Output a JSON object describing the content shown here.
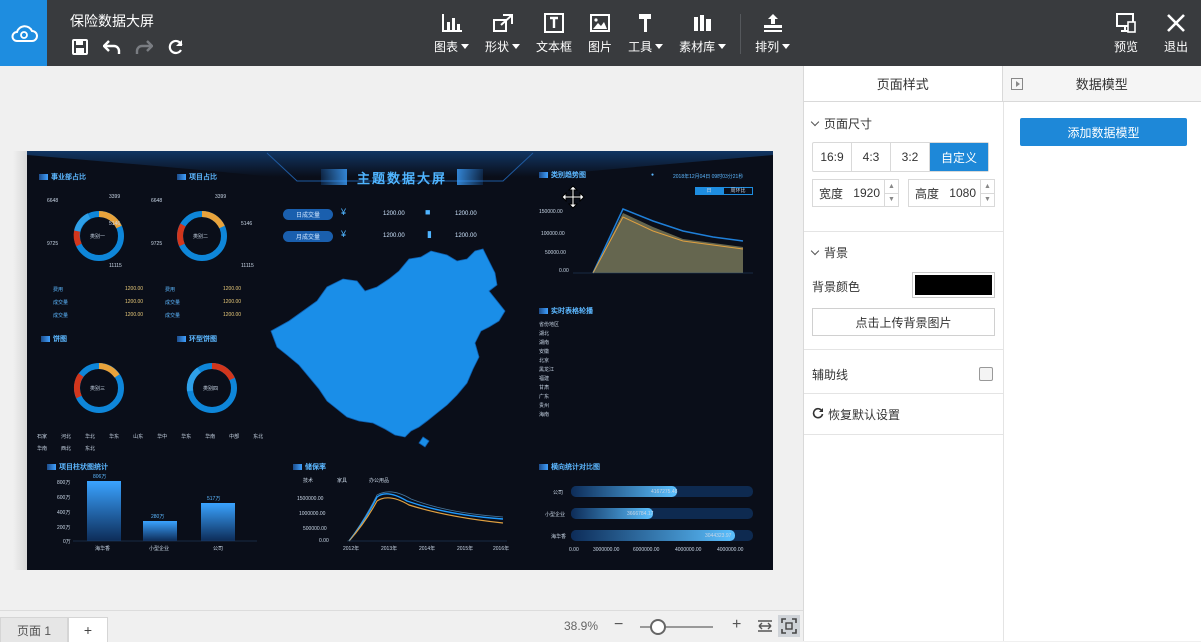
{
  "app": {
    "title": "保险数据大屏"
  },
  "toolbar": {
    "items": [
      {
        "label": "图表",
        "icon": "bar-chart-icon",
        "dropdown": true
      },
      {
        "label": "形状",
        "icon": "shape-icon",
        "dropdown": true
      },
      {
        "label": "文本框",
        "icon": "textbox-icon",
        "dropdown": false
      },
      {
        "label": "图片",
        "icon": "image-icon",
        "dropdown": false
      },
      {
        "label": "工具",
        "icon": "hammer-icon",
        "dropdown": true
      },
      {
        "label": "素材库",
        "icon": "library-icon",
        "dropdown": true
      },
      {
        "label": "排列",
        "icon": "arrange-icon",
        "dropdown": true
      }
    ],
    "preview_label": "预览",
    "exit_label": "退出"
  },
  "dashboard": {
    "title": "主题数据大屏",
    "sections": {
      "dept": "事业部占比",
      "project": "项目占比",
      "pie": "饼图",
      "ring": "环型饼图",
      "trend": "类别趋势图",
      "table": "实时表格轮播",
      "bar": "项目柱状图统计",
      "line": "储保率",
      "hbar": "横向统计对比图"
    },
    "kpi": {
      "daily": "日成交量",
      "monthly": "月成交量",
      "v1": "1200.00",
      "v2": "1200.00",
      "v3": "1200.00",
      "v4": "1200.00"
    },
    "donuts": {
      "d1": "类别一",
      "d2": "类别二",
      "d3": "类别三",
      "d4": "类别四"
    },
    "donut_labels": {
      "a": "6648",
      "b": "3399",
      "c": "5146",
      "d": "9725",
      "e": "11115",
      "f": "3399",
      "g": "6648",
      "h": "5146",
      "i": "9725",
      "j": "11115"
    },
    "stats": {
      "rows": [
        {
          "k": "费用",
          "v": "1200.00"
        },
        {
          "k": "成交量",
          "v": "1200.00"
        },
        {
          "k": "成交量",
          "v": "1200.00"
        }
      ],
      "rows2": [
        {
          "k": "费用",
          "v": "1200.00"
        },
        {
          "k": "成交量",
          "v": "1200.00"
        },
        {
          "k": "成交量",
          "v": "1200.00"
        }
      ]
    },
    "legend": [
      "石家",
      "河北",
      "华北",
      "华东",
      "山东",
      "华中",
      "华东",
      "华南",
      "中部",
      "东北",
      "华南",
      "西北",
      "东北"
    ],
    "table_rows": [
      "省份地区",
      "湖北",
      "湖南",
      "安徽",
      "北京",
      "黑龙江",
      "福建",
      "甘肃",
      "广东",
      "贵州",
      "海南"
    ],
    "trend": {
      "date": "2018年12月04日 09时03分21秒",
      "toggle_a": "日",
      "toggle_b": "周环比",
      "y": [
        "150000.00",
        "100000.00",
        "50000.00",
        "0.00"
      ]
    },
    "bar": {
      "labels": [
        "806万",
        "280万",
        "517万"
      ],
      "cats": [
        "海华香",
        "小型企业",
        "公司"
      ],
      "y": [
        "800万",
        "600万",
        "400万",
        "200万",
        "0万"
      ]
    },
    "line": {
      "legend": [
        "技术",
        "家具",
        "办公用品"
      ],
      "y": [
        "1500000.00",
        "1000000.00",
        "500000.00",
        "0.00"
      ],
      "x": [
        "2012年",
        "2013年",
        "2014年",
        "2015年",
        "2016年"
      ]
    },
    "hbar": {
      "cats": [
        "公司",
        "小型企业",
        "海华香"
      ],
      "vals": [
        "4167275.48",
        "3666784.17",
        "3044323.97"
      ],
      "x": [
        "0.00",
        "3000000.00",
        "6000000.00",
        "4000000.00",
        "4000000.00"
      ]
    }
  },
  "panel": {
    "tab_page_style": "页面样式",
    "tab_data_model": "数据模型",
    "page_size_label": "页面尺寸",
    "ratios": [
      "16:9",
      "4:3",
      "3:2",
      "自定义"
    ],
    "width_label": "宽度",
    "width_value": "1920",
    "height_label": "高度",
    "height_value": "1080",
    "background_label": "背景",
    "bg_color_label": "背景颜色",
    "bg_color": "#000000",
    "upload_label": "点击上传背景图片",
    "guides_label": "辅助线",
    "restore_label": "恢复默认设置",
    "add_model_label": "添加数据模型"
  },
  "bottom": {
    "page_tab": "页面 1",
    "add_page": "+",
    "zoom": "38.9%",
    "minus": "−",
    "plus": "+"
  }
}
